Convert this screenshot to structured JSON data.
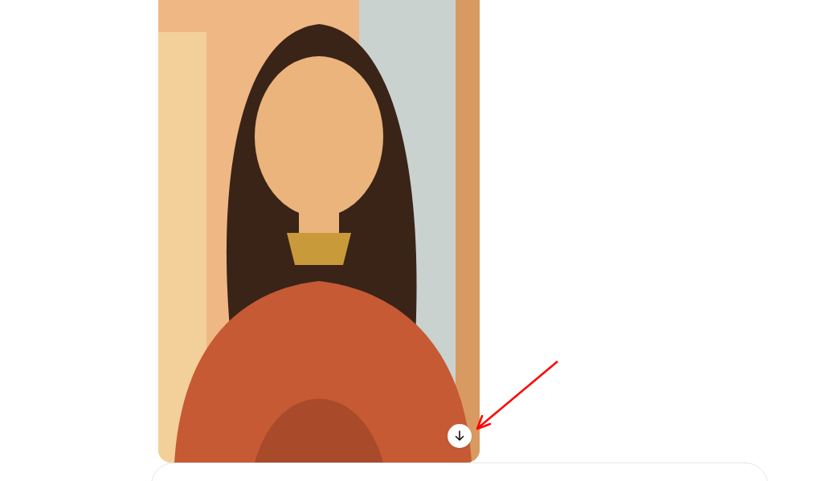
{
  "image": {
    "kind": "picture",
    "download": true
  },
  "annotation": {
    "kind": "arrow",
    "color": "#ff0000"
  },
  "composer": {
    "kind": "input"
  }
}
